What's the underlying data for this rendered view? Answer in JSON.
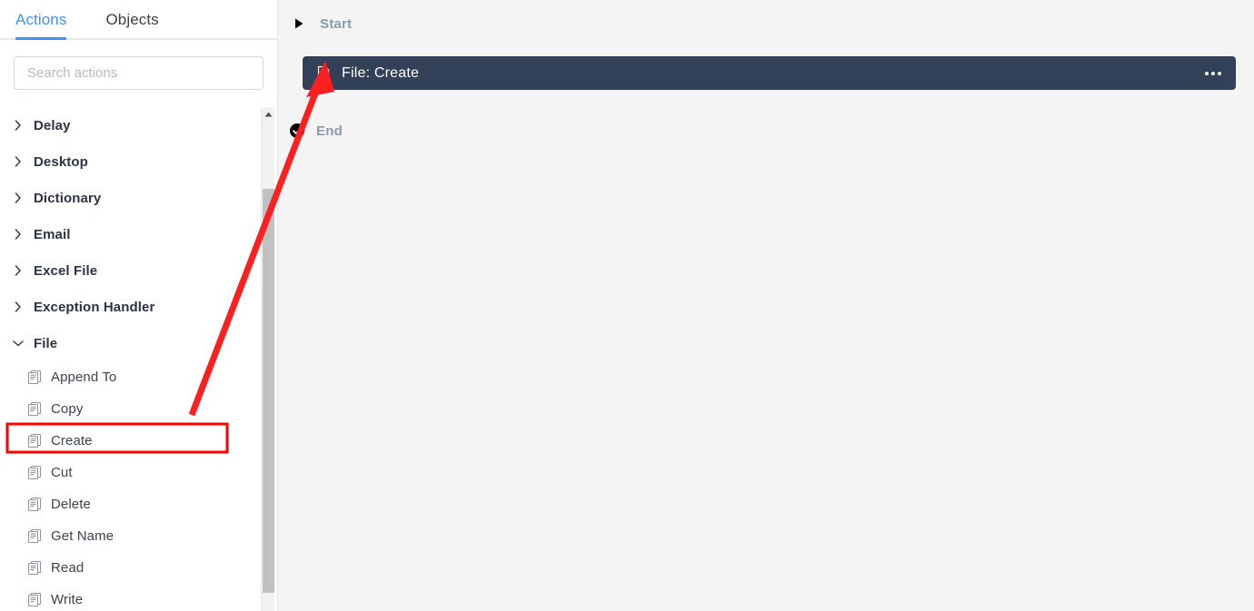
{
  "sidebar": {
    "tabs": [
      {
        "label": "Actions",
        "active": true
      },
      {
        "label": "Objects",
        "active": false
      }
    ],
    "search": {
      "placeholder": "Search actions",
      "value": ""
    },
    "categories": [
      {
        "label": "Delay",
        "expanded": false
      },
      {
        "label": "Desktop",
        "expanded": false
      },
      {
        "label": "Dictionary",
        "expanded": false
      },
      {
        "label": "Email",
        "expanded": false
      },
      {
        "label": "Excel File",
        "expanded": false
      },
      {
        "label": "Exception Handler",
        "expanded": false
      },
      {
        "label": "File",
        "expanded": true
      }
    ],
    "file_actions": [
      {
        "label": "Append To",
        "icon": "file-document-icon",
        "highlighted": false
      },
      {
        "label": "Copy",
        "icon": "file-document-icon",
        "highlighted": false
      },
      {
        "label": "Create",
        "icon": "file-document-icon",
        "highlighted": true
      },
      {
        "label": "Cut",
        "icon": "file-document-icon",
        "highlighted": false
      },
      {
        "label": "Delete",
        "icon": "file-document-icon",
        "highlighted": false
      },
      {
        "label": "Get Name",
        "icon": "file-document-icon",
        "highlighted": false
      },
      {
        "label": "Read",
        "icon": "file-document-icon",
        "highlighted": false
      },
      {
        "label": "Write",
        "icon": "file-document-icon",
        "highlighted": false
      }
    ],
    "scrollbar": {
      "up_arrow": "scroll-up-arrow-icon"
    }
  },
  "canvas": {
    "start_node": {
      "label": "Start",
      "icon": "play-triangle-icon"
    },
    "action_node": {
      "label": "File: Create",
      "icon": "file-document-icon",
      "menu_icon": "ellipsis-icon"
    },
    "end_node": {
      "label": "End",
      "icon": "check-circle-icon"
    }
  },
  "annotation": {
    "highlight_color": "#ff0000",
    "arrow_color": "#fa2020",
    "target_label": "Create"
  },
  "colors": {
    "accent": "#3d95f2",
    "action_bar_bg": "#324157",
    "canvas_bg": "#f4f4f5",
    "node_text": "#8d9aab"
  }
}
